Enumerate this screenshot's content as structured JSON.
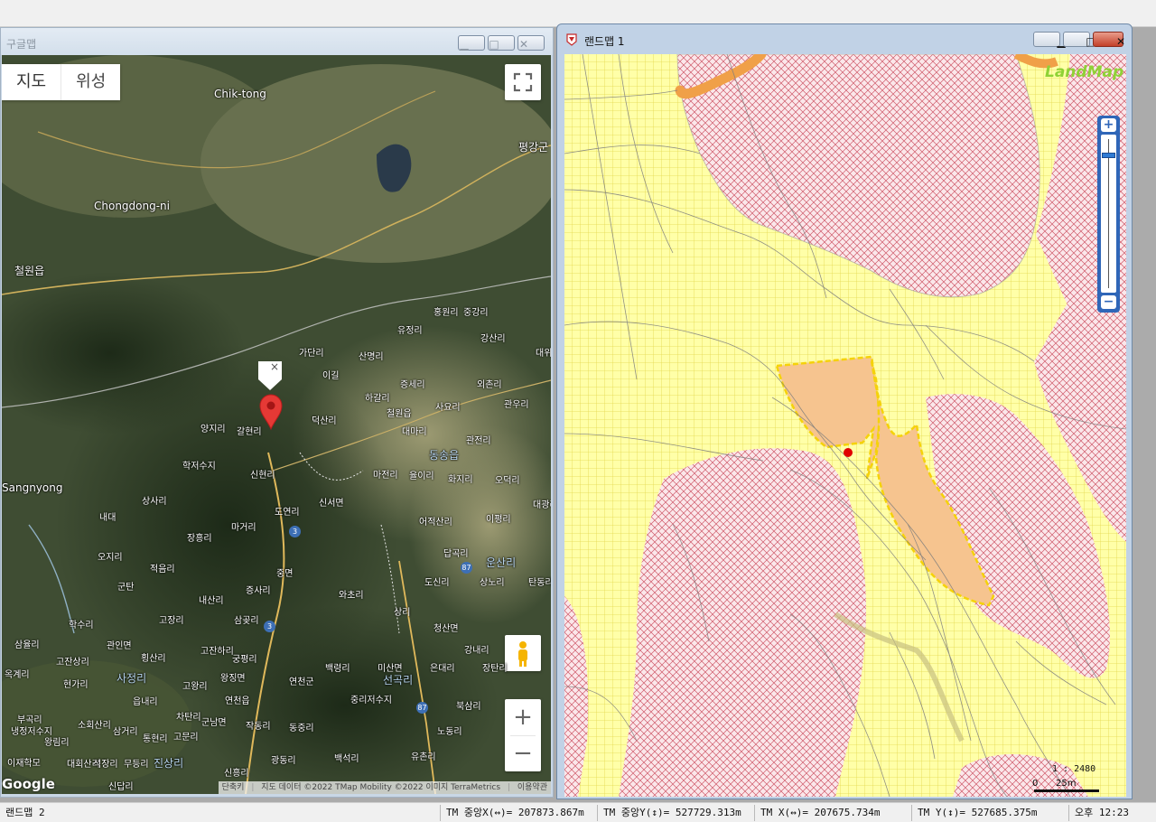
{
  "google_window": {
    "title": "구글맵",
    "map_type_map": "지도",
    "map_type_satellite": "위성",
    "marker_close": "×",
    "zoom_in": "+",
    "zoom_out": "−",
    "logo": "Google",
    "attribution": {
      "shortcuts": "단축키",
      "data": "지도 데이터 ©2022 TMap Mobility ©2022 이미지 TerraMetrics",
      "terms": "이용약관"
    },
    "labels": [
      "Chik-tong",
      "평강군",
      "Chongdong-ni",
      "철원읍",
      "Sangnyong",
      "유정리",
      "홍원리",
      "중강리",
      "강산리",
      "가단리",
      "산명리",
      "대위리",
      "이길",
      "증세리",
      "외촌리",
      "하갈리",
      "철원읍",
      "사요리",
      "관우리",
      "양지리",
      "갈현리",
      "덕산리",
      "대마리",
      "관전리",
      "동송읍",
      "학저수지",
      "신현리",
      "마전리",
      "율이리",
      "화지리",
      "오덕리",
      "상사리",
      "도연리",
      "신서면",
      "대광리",
      "내대",
      "어적산리",
      "이평리",
      "장흥리",
      "마거리",
      "답곡리",
      "오지리",
      "적음리",
      "중면",
      "도신리",
      "상노리",
      "탄동리",
      "군탄",
      "증사리",
      "와초리",
      "내산리",
      "학수리",
      "고장리",
      "삼곶리",
      "상리",
      "청산면",
      "삼율리",
      "관인면",
      "고잔상리",
      "횡산리",
      "고잔하리",
      "궁평리",
      "강내리",
      "옥계리",
      "현가리",
      "사정리",
      "고왕리",
      "왕징면",
      "연천군",
      "선곡리",
      "읍내리",
      "연천읍",
      "중리저수지",
      "북삼리",
      "차탄리",
      "부곡리",
      "소회산리",
      "삼거리",
      "군남면",
      "작동리",
      "동중리",
      "노동리",
      "왕림리",
      "통현리",
      "고문리",
      "대회산리",
      "석장리",
      "무등리",
      "진상리",
      "광동리",
      "백석리",
      "유촌리",
      "이재학모",
      "신답리",
      "신흥리",
      "운산리",
      "백령리",
      "미산면",
      "은대리",
      "장탄리",
      "냉정저수지"
    ],
    "routes": [
      "3",
      "87",
      "3",
      "87"
    ]
  },
  "landmap_window": {
    "title": "랜드맵 1",
    "logo": "LandMap",
    "zoom_plus": "+",
    "zoom_minus": "−",
    "scale_ratio": "1 : 2480",
    "scale_zero": "0",
    "scale_len": "25m"
  },
  "status_bar": {
    "doc": "랜드맵 2",
    "tm_center_x": "TM 중앙X(↔)= 207873.867m",
    "tm_center_y": "TM 중앙Y(↕)= 527729.313m",
    "tm_x": "TM X(↔)= 207675.734m",
    "tm_y": "TM Y(↕)= 527685.375m",
    "time": "오후 12:23"
  }
}
